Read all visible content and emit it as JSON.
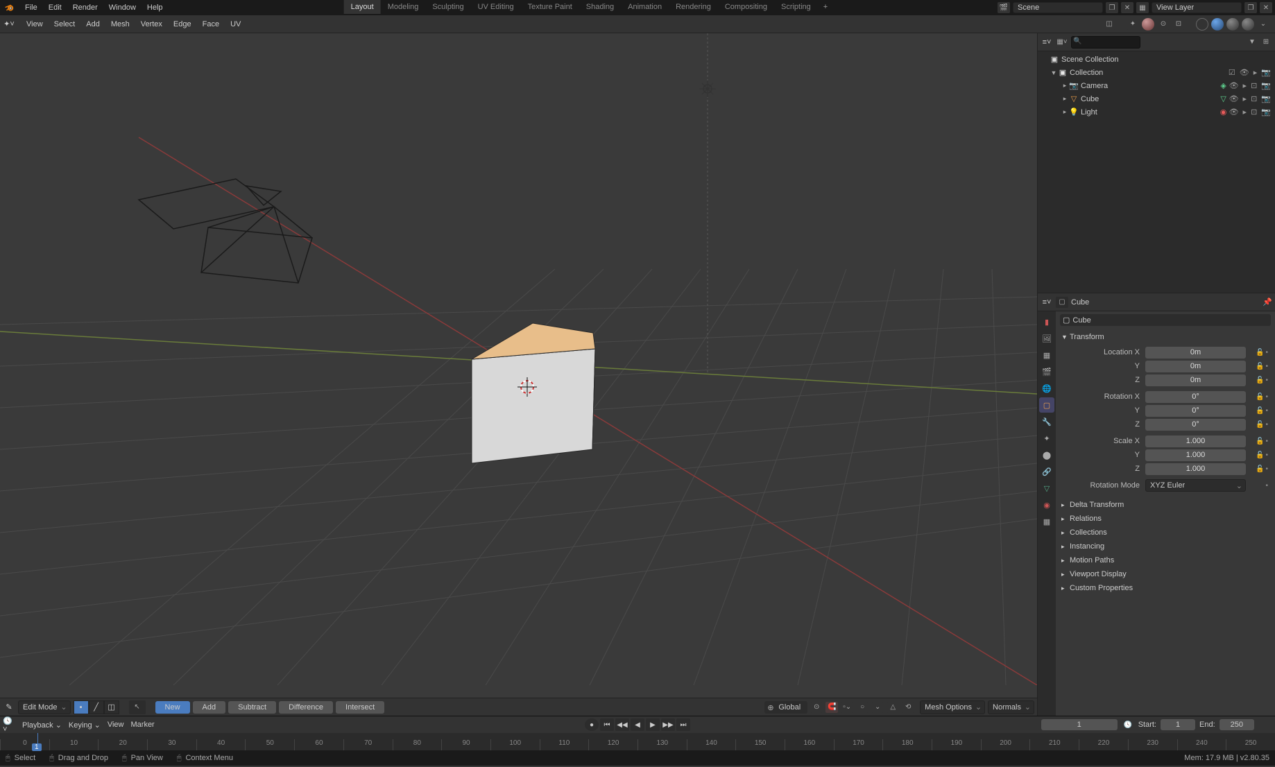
{
  "topmenu": {
    "file": "File",
    "edit": "Edit",
    "render": "Render",
    "window": "Window",
    "help": "Help"
  },
  "workspaces": {
    "layout": "Layout",
    "modeling": "Modeling",
    "sculpting": "Sculpting",
    "uv": "UV Editing",
    "texpaint": "Texture Paint",
    "shading": "Shading",
    "anim": "Animation",
    "rendering": "Rendering",
    "compositing": "Compositing",
    "scripting": "Scripting",
    "add": "+"
  },
  "scene": {
    "label": "Scene",
    "vlayer": "View Layer"
  },
  "viewmenu": {
    "view": "View",
    "select": "Select",
    "add": "Add",
    "mesh": "Mesh",
    "vertex": "Vertex",
    "edge": "Edge",
    "face": "Face",
    "uv": "UV"
  },
  "outliner": {
    "scene": "Scene Collection",
    "collection": "Collection",
    "camera": "Camera",
    "cube": "Cube",
    "light": "Light"
  },
  "props_object_name": "Cube",
  "props_data_name": "Cube",
  "transform": {
    "title": "Transform",
    "locx_lbl": "Location X",
    "locx": "0m",
    "locy_lbl": "Y",
    "locy": "0m",
    "locz_lbl": "Z",
    "locz": "0m",
    "rotx_lbl": "Rotation X",
    "rotx": "0°",
    "roty_lbl": "Y",
    "roty": "0°",
    "rotz_lbl": "Z",
    "rotz": "0°",
    "sclx_lbl": "Scale X",
    "sclx": "1.000",
    "scly_lbl": "Y",
    "scly": "1.000",
    "sclz_lbl": "Z",
    "sclz": "1.000",
    "rotmode_lbl": "Rotation Mode",
    "rotmode": "XYZ Euler"
  },
  "panels": {
    "delta": "Delta Transform",
    "relations": "Relations",
    "collections": "Collections",
    "instancing": "Instancing",
    "motion": "Motion Paths",
    "viewport": "Viewport Display",
    "custom": "Custom Properties"
  },
  "bottombar": {
    "mode": "Edit Mode",
    "new": "New",
    "add": "Add",
    "subtract": "Subtract",
    "difference": "Difference",
    "intersect": "Intersect",
    "orient": "Global",
    "meshopts": "Mesh Options",
    "normals": "Normals"
  },
  "timeline": {
    "playback": "Playback",
    "keying": "Keying",
    "view": "View",
    "marker": "Marker",
    "current": "1",
    "start_lbl": "Start:",
    "start": "1",
    "end_lbl": "End:",
    "end": "250",
    "ticks": [
      "0",
      "10",
      "20",
      "30",
      "40",
      "50",
      "60",
      "70",
      "80",
      "90",
      "100",
      "110",
      "120",
      "130",
      "140",
      "150",
      "160",
      "170",
      "180",
      "190",
      "200",
      "210",
      "220",
      "230",
      "240",
      "250"
    ]
  },
  "status": {
    "select": "Select",
    "drag": "Drag and Drop",
    "pan": "Pan View",
    "ctx": "Context Menu",
    "mem": "Mem: 17.9 MB | v2.80.35"
  }
}
